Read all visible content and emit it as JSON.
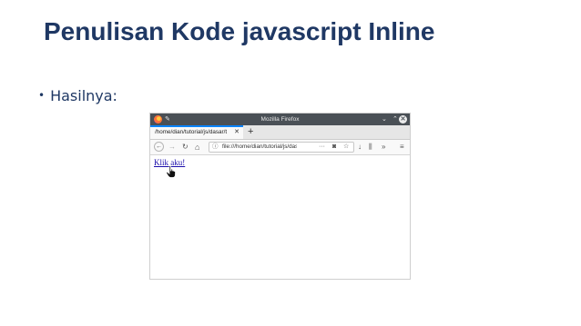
{
  "slide": {
    "title": "Penulisan Kode javascript Inline",
    "bullet": "Hasilnya:"
  },
  "browser": {
    "window_title": "Mozilla Firefox",
    "tab_title": "/home/dian/tutorial/js/dasar/t",
    "tab_close": "✕",
    "new_tab": "+",
    "back": "←",
    "forward": "→",
    "reload": "↻",
    "home": "⌂",
    "url_info": "ⓘ",
    "url": "file:///home/dian/tutorial/js/dasar",
    "url_more": "···",
    "pocket": "◙",
    "bookmark_star": "☆",
    "download": "↓",
    "library": "⫼",
    "overflow": "»",
    "menu": "≡",
    "win_minimize": "⌄",
    "win_maximize": "⌃",
    "win_close": "✕",
    "page_link": "Klik aku!"
  }
}
